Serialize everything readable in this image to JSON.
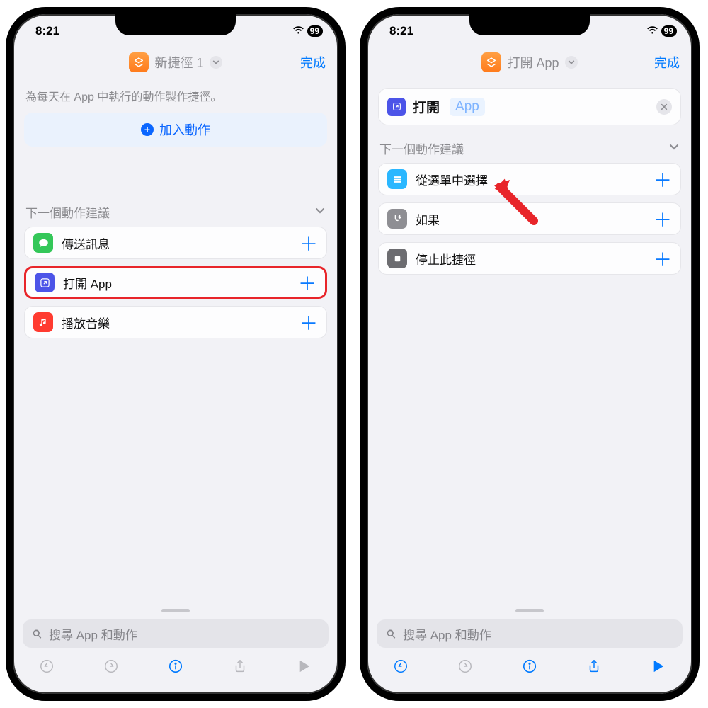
{
  "status": {
    "time": "8:21",
    "battery": "99"
  },
  "phoneA": {
    "title": "新捷徑 1",
    "done": "完成",
    "intro": "為每天在 App 中執行的動作製作捷徑。",
    "addAction": "加入動作",
    "suggestHeader": "下一個動作建議",
    "rows": [
      {
        "label": "傳送訊息"
      },
      {
        "label": "打開 App"
      },
      {
        "label": "播放音樂"
      }
    ],
    "searchPlaceholder": "搜尋 App 和動作"
  },
  "phoneB": {
    "title": "打開 App",
    "done": "完成",
    "action": {
      "verb": "打開",
      "param": "App"
    },
    "suggestHeader": "下一個動作建議",
    "rows": [
      {
        "label": "從選單中選擇"
      },
      {
        "label": "如果"
      },
      {
        "label": "停止此捷徑"
      }
    ],
    "searchPlaceholder": "搜尋 App 和動作"
  }
}
